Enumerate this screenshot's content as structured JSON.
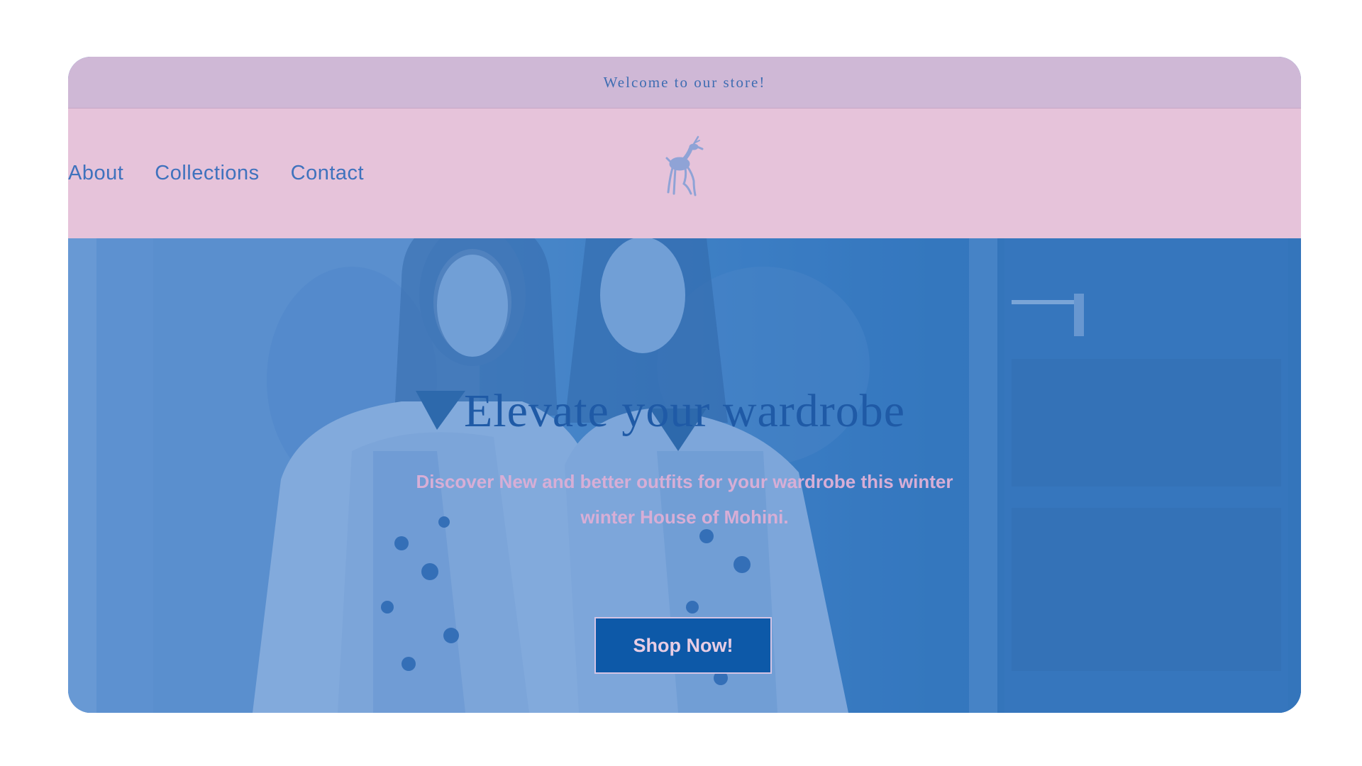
{
  "announcement": {
    "text": "Welcome to our store!"
  },
  "nav": {
    "items": [
      {
        "label": "About"
      },
      {
        "label": "Collections"
      },
      {
        "label": "Contact"
      }
    ]
  },
  "header": {
    "logo_icon": "deer-logo-icon"
  },
  "hero": {
    "title": "Elevate your wardrobe",
    "subtitle": "Discover New and better outfits for your wardrobe this winter winter House of Mohini.",
    "cta_label": "Shop Now!",
    "image": "two-women-in-embroidered-dresses-photo"
  },
  "colors": {
    "announcement_bg": "#cfb8d6",
    "header_bg": "#e6c3da",
    "nav_text": "#3f72bd",
    "hero_tint": "#3d7fc4",
    "cta_bg": "#0d59a8"
  }
}
